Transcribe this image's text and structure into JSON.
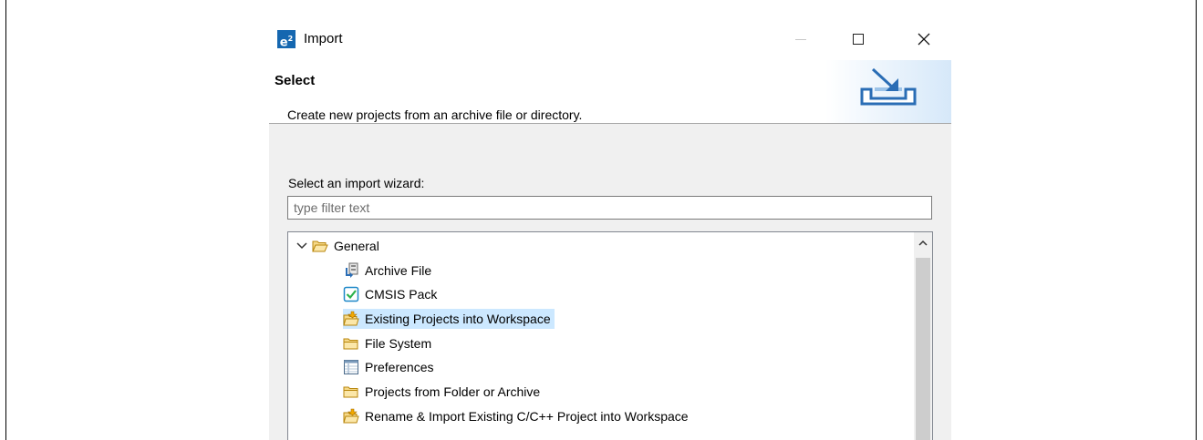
{
  "window": {
    "title": "Import",
    "logo_text": "e",
    "logo_superscript": "2",
    "logo_color": "#1567b0"
  },
  "header": {
    "title": "Select",
    "description": "Create new projects from an archive file or directory.",
    "banner_icon": "import-wizard-icon"
  },
  "wizard": {
    "label": "Select an import wizard:",
    "filter_placeholder": "type filter text",
    "filter_value": ""
  },
  "tree": {
    "group": {
      "label": "General",
      "expanded": true,
      "icon": "folder-open-icon"
    },
    "items": [
      {
        "label": "Archive File",
        "icon": "archive-file-icon"
      },
      {
        "label": "CMSIS Pack",
        "icon": "cmsis-pack-icon"
      },
      {
        "label": "Existing Projects into Workspace",
        "icon": "import-projects-icon",
        "selected": true
      },
      {
        "label": "File System",
        "icon": "folder-icon"
      },
      {
        "label": "Preferences",
        "icon": "preferences-icon"
      },
      {
        "label": "Projects from Folder or Archive",
        "icon": "folder-icon"
      },
      {
        "label": "Rename & Import Existing C/C++ Project into Workspace",
        "icon": "import-projects-icon"
      }
    ],
    "selection_color": "#cce8ff"
  }
}
